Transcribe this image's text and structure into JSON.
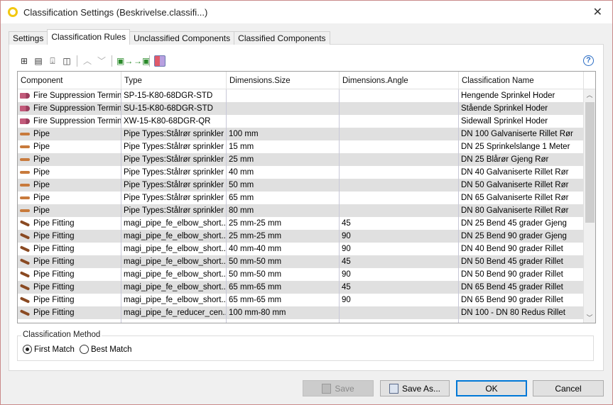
{
  "window": {
    "title": "Classification Settings (Beskrivelse.classifi...)",
    "close": "✕"
  },
  "tabs": [
    {
      "label": "Settings",
      "active": false
    },
    {
      "label": "Classification Rules",
      "active": true
    },
    {
      "label": "Unclassified Components",
      "active": false
    },
    {
      "label": "Classified Components",
      "active": false
    }
  ],
  "toolbar": {
    "icons": [
      "add-row-icon",
      "insert-row-icon",
      "delete-row-icon",
      "add-column-icon",
      "move-up-icon",
      "move-down-icon",
      "export-excel-icon",
      "import-excel-icon",
      "color-toggle-icon"
    ],
    "help": "?"
  },
  "table": {
    "columns": [
      "Component",
      "Type",
      "Dimensions.Size",
      "Dimensions.Angle",
      "Classification Name"
    ],
    "rows": [
      {
        "icon": "term",
        "component": "Fire Suppression Terminal",
        "type": "SP-15-K80-68DGR-STD",
        "size": "",
        "angle": "",
        "name": "Hengende Sprinkel Hoder"
      },
      {
        "icon": "term",
        "component": "Fire Suppression Terminal",
        "type": "SU-15-K80-68DGR-STD",
        "size": "",
        "angle": "",
        "name": "Stående Sprinkel Hoder"
      },
      {
        "icon": "term",
        "component": "Fire Suppression Terminal",
        "type": "XW-15-K80-68DGR-QR",
        "size": "",
        "angle": "",
        "name": "Sidewall Sprinkel Hoder"
      },
      {
        "icon": "pipe",
        "component": "Pipe",
        "type": "Pipe Types:Stålrør sprinkler",
        "size": "100 mm",
        "angle": "",
        "name": "DN 100 Galvaniserte Rillet Rør"
      },
      {
        "icon": "pipe",
        "component": "Pipe",
        "type": "Pipe Types:Stålrør sprinkler",
        "size": "15 mm",
        "angle": "",
        "name": "DN 25 Sprinkelslange 1 Meter"
      },
      {
        "icon": "pipe",
        "component": "Pipe",
        "type": "Pipe Types:Stålrør sprinkler",
        "size": "25 mm",
        "angle": "",
        "name": "DN 25 Blårør Gjeng Rør"
      },
      {
        "icon": "pipe",
        "component": "Pipe",
        "type": "Pipe Types:Stålrør sprinkler",
        "size": "40 mm",
        "angle": "",
        "name": "DN 40 Galvaniserte Rillet Rør"
      },
      {
        "icon": "pipe",
        "component": "Pipe",
        "type": "Pipe Types:Stålrør sprinkler",
        "size": "50 mm",
        "angle": "",
        "name": "DN 50 Galvaniserte Rillet Rør"
      },
      {
        "icon": "pipe",
        "component": "Pipe",
        "type": "Pipe Types:Stålrør sprinkler",
        "size": "65 mm",
        "angle": "",
        "name": "DN 65 Galvaniserte Rillet Rør"
      },
      {
        "icon": "pipe",
        "component": "Pipe",
        "type": "Pipe Types:Stålrør sprinkler",
        "size": "80 mm",
        "angle": "",
        "name": "DN 80 Galvaniserte Rillet Rør"
      },
      {
        "icon": "fit",
        "component": "Pipe Fitting",
        "type": "magi_pipe_fe_elbow_short...",
        "size": "25 mm-25 mm",
        "angle": "45",
        "name": "DN 25 Bend 45 grader Gjeng"
      },
      {
        "icon": "fit",
        "component": "Pipe Fitting",
        "type": "magi_pipe_fe_elbow_short...",
        "size": "25 mm-25 mm",
        "angle": "90",
        "name": "DN 25 Bend 90 grader Gjeng"
      },
      {
        "icon": "fit",
        "component": "Pipe Fitting",
        "type": "magi_pipe_fe_elbow_short...",
        "size": "40 mm-40 mm",
        "angle": "90",
        "name": "DN 40 Bend 90 grader Rillet"
      },
      {
        "icon": "fit",
        "component": "Pipe Fitting",
        "type": "magi_pipe_fe_elbow_short...",
        "size": "50 mm-50 mm",
        "angle": "45",
        "name": "DN 50 Bend 45 grader Rillet"
      },
      {
        "icon": "fit",
        "component": "Pipe Fitting",
        "type": "magi_pipe_fe_elbow_short...",
        "size": "50 mm-50 mm",
        "angle": "90",
        "name": "DN 50 Bend 90 grader Rillet"
      },
      {
        "icon": "fit",
        "component": "Pipe Fitting",
        "type": "magi_pipe_fe_elbow_short...",
        "size": "65 mm-65 mm",
        "angle": "45",
        "name": "DN 65 Bend 45 grader Rillet"
      },
      {
        "icon": "fit",
        "component": "Pipe Fitting",
        "type": "magi_pipe_fe_elbow_short...",
        "size": "65 mm-65 mm",
        "angle": "90",
        "name": "DN 65 Bend 90 grader Rillet"
      },
      {
        "icon": "fit",
        "component": "Pipe Fitting",
        "type": "magi_pipe_fe_reducer_cen...",
        "size": "100 mm-80 mm",
        "angle": "",
        "name": "DN 100 - DN 80 Redus Rillet"
      }
    ]
  },
  "method": {
    "label": "Classification Method",
    "options": [
      {
        "label": "First Match",
        "selected": true
      },
      {
        "label": "Best Match",
        "selected": false
      }
    ]
  },
  "buttons": {
    "save": "Save",
    "save_as": "Save As...",
    "ok": "OK",
    "cancel": "Cancel"
  }
}
